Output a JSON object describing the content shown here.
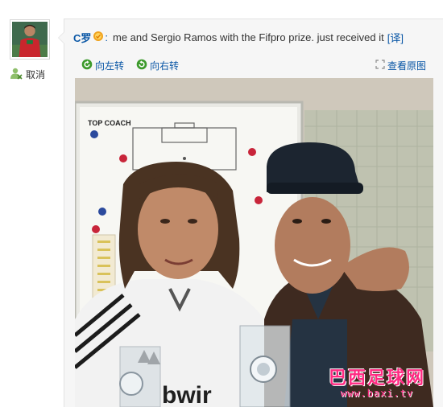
{
  "user": {
    "name": "C罗",
    "colon": ":",
    "badge_icon": "vip-medal-icon"
  },
  "post": {
    "text": "me and Sergio Ramos with the Fifpro prize. just received it",
    "translate_label": "[译]"
  },
  "sidebar": {
    "cancel_label": "取消",
    "cancel_icon": "unfollow-user-icon"
  },
  "toolbar": {
    "rotate_left_label": "向左转",
    "rotate_right_label": "向右转",
    "view_original_label": "查看原图"
  },
  "photo": {
    "board_label": "TOP COACH"
  },
  "watermark": {
    "site_name": "巴西足球网",
    "url": "www.baxi.tv"
  },
  "colors": {
    "link": "#0a57a6",
    "watermark": "#ff2a82",
    "rotate_icon": "#3d9a2c"
  }
}
